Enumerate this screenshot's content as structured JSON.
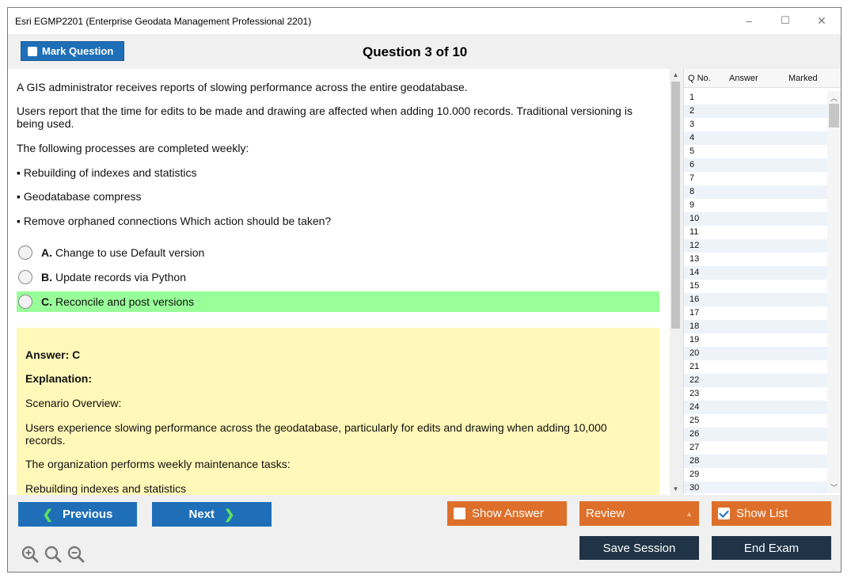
{
  "window": {
    "title": "Esri EGMP2201 (Enterprise Geodata Management Professional 2201)",
    "controls": {
      "minimize": "–",
      "maximize": "☐",
      "close": "✕"
    }
  },
  "header": {
    "mark_label": "Mark Question",
    "question_title": "Question 3 of 10"
  },
  "question": {
    "paragraphs": [
      "A GIS administrator receives reports of slowing performance across the entire geodatabase.",
      "Users report that the time for edits to be made and drawing are affected when adding 10.000 records. Traditional versioning is being used.",
      "The following processes are completed weekly:",
      "▪ Rebuilding of indexes and statistics",
      "▪ Geodatabase compress",
      "▪ Remove orphaned connections Which action should be taken?"
    ],
    "options": [
      {
        "letter": "A.",
        "text": "Change to use Default version"
      },
      {
        "letter": "B.",
        "text": "Update records via Python"
      },
      {
        "letter": "C.",
        "text": "Reconcile and post versions"
      }
    ]
  },
  "answer": {
    "answer_line": "Answer: C",
    "explanation_label": "Explanation:",
    "lines": [
      "Scenario Overview:",
      "Users experience slowing performance across the geodatabase, particularly for edits and drawing when adding 10,000 records.",
      "The organization performs weekly maintenance tasks:",
      "Rebuilding indexes and statistics"
    ]
  },
  "question_list": {
    "headers": {
      "no": "Q No.",
      "answer": "Answer",
      "marked": "Marked"
    },
    "rows": [
      "1",
      "2",
      "3",
      "4",
      "5",
      "6",
      "7",
      "8",
      "9",
      "10",
      "11",
      "12",
      "13",
      "14",
      "15",
      "16",
      "17",
      "18",
      "19",
      "20",
      "21",
      "22",
      "23",
      "24",
      "25",
      "26",
      "27",
      "28",
      "29",
      "30"
    ]
  },
  "footer": {
    "previous_label": "Previous",
    "next_label": "Next",
    "show_answer_label": "Show Answer",
    "review_label": "Review",
    "show_list_label": "Show List",
    "save_session_label": "Save Session",
    "end_exam_label": "End Exam",
    "show_list_checked": true,
    "show_answer_checked": false
  },
  "colors": {
    "primary_blue": "#1f6fb8",
    "orange": "#dd6f2a",
    "dark_navy": "#1f3447",
    "correct_green": "#99ff99",
    "answer_yellow": "#fff8b8"
  },
  "icons": [
    "zoom-in-icon",
    "zoom-reset-icon",
    "zoom-out-icon",
    "chevron-left-icon",
    "chevron-right-icon",
    "caret-down-icon"
  ]
}
